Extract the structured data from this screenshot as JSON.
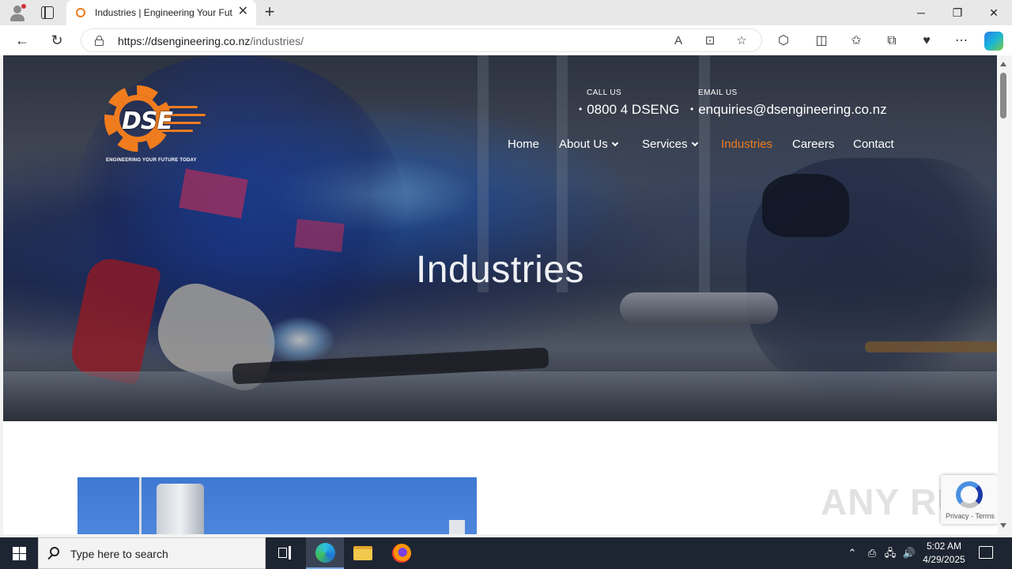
{
  "browser": {
    "tab_title": "Industries | Engineering Your Fut",
    "tab_close": "✕",
    "new_tab": "+",
    "url_host": "https://dsengineering.co.nz",
    "url_path": "/industries/",
    "window_minimize": "─",
    "window_restore": "❐",
    "window_close": "✕",
    "back": "←",
    "refresh": "↻",
    "read_aloud": "A",
    "immersive": "⊡",
    "favorite": "☆",
    "extensions": "⬡",
    "split": "◫",
    "favorites_bar": "✩",
    "collections": "⧉",
    "performance": "♥",
    "more": "⋯"
  },
  "site": {
    "logo_mark": "DSE",
    "logo_tagline": "ENGINEERING YOUR FUTURE TODAY",
    "call_label": "CALL US",
    "call_value": "0800 4 DSENG",
    "email_label": "EMAIL US",
    "email_value": "enquiries@dsengineering.co.nz",
    "menu": {
      "home": "Home",
      "about": "About Us",
      "services": "Services",
      "industries": "Industries",
      "careers": "Careers",
      "contact": "Contact"
    },
    "hero_title": "Industries",
    "accent_color": "#f07c1e"
  },
  "overlay": {
    "watermark": "ANY RUN",
    "recaptcha_text": "Privacy - Terms"
  },
  "taskbar": {
    "search_placeholder": "Type here to search",
    "time": "5:02 AM",
    "date": "4/29/2025",
    "tray_chevron": "⌃",
    "tray_volume": "🔊"
  }
}
